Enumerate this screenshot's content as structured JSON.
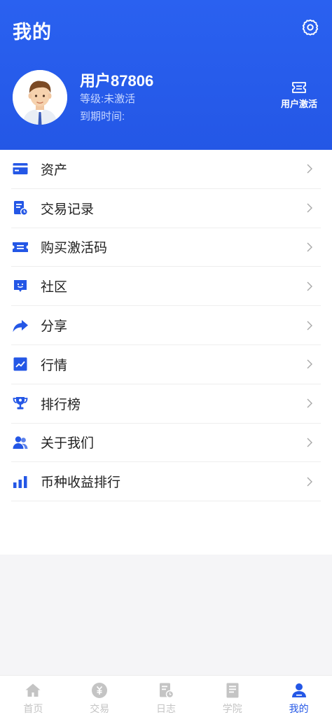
{
  "header": {
    "title": "我的",
    "settings_icon": "gear-icon"
  },
  "user": {
    "name": "用户87806",
    "level": "等级:未激活",
    "expire": "到期时间:",
    "activate_label": "用户激活"
  },
  "menu": {
    "items": [
      {
        "label": "资产",
        "icon": "wallet-icon"
      },
      {
        "label": "交易记录",
        "icon": "record-icon"
      },
      {
        "label": "购买激活码",
        "icon": "ticket-icon"
      },
      {
        "label": "社区",
        "icon": "chat-icon"
      },
      {
        "label": "分享",
        "icon": "share-icon"
      },
      {
        "label": "行情",
        "icon": "market-icon"
      },
      {
        "label": "排行榜",
        "icon": "trophy-icon"
      },
      {
        "label": "关于我们",
        "icon": "users-icon"
      },
      {
        "label": "币种收益排行",
        "icon": "bar-chart-icon"
      }
    ]
  },
  "tabbar": {
    "tabs": [
      {
        "label": "首页",
        "icon": "home-icon",
        "active": false
      },
      {
        "label": "交易",
        "icon": "coin-icon",
        "active": false
      },
      {
        "label": "日志",
        "icon": "log-icon",
        "active": false
      },
      {
        "label": "学院",
        "icon": "book-icon",
        "active": false
      },
      {
        "label": "我的",
        "icon": "person-icon",
        "active": true
      }
    ]
  },
  "colors": {
    "primary": "#2457e6",
    "inactive": "#c4c4c4",
    "background": "#f5f5f7"
  }
}
